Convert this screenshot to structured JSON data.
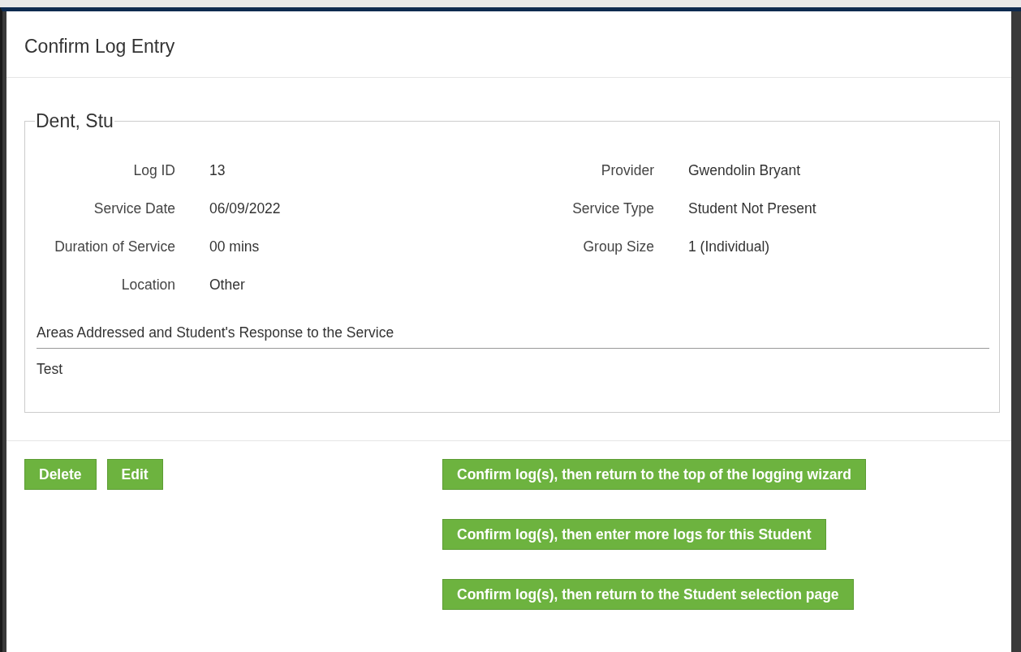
{
  "modal": {
    "title": "Confirm Log Entry"
  },
  "student": {
    "name": "Dent, Stu"
  },
  "details_left": [
    {
      "label": "Log ID",
      "value": "13"
    },
    {
      "label": "Service Date",
      "value": "06/09/2022"
    },
    {
      "label": "Duration of Service",
      "value": "00 mins"
    },
    {
      "label": "Location",
      "value": "Other"
    }
  ],
  "details_right": [
    {
      "label": "Provider",
      "value": "Gwendolin Bryant"
    },
    {
      "label": "Service Type",
      "value": "Student Not Present"
    },
    {
      "label": "Group Size",
      "value": "1 (Individual)"
    }
  ],
  "response": {
    "heading": "Areas Addressed and Student's Response to the Service",
    "text": "Test"
  },
  "buttons_left": [
    "Delete",
    "Edit"
  ],
  "buttons_right": [
    "Confirm log(s), then return to the top of the logging wizard",
    "Confirm log(s), then enter more logs for this Student",
    "Confirm log(s), then return to the Student selection page"
  ]
}
